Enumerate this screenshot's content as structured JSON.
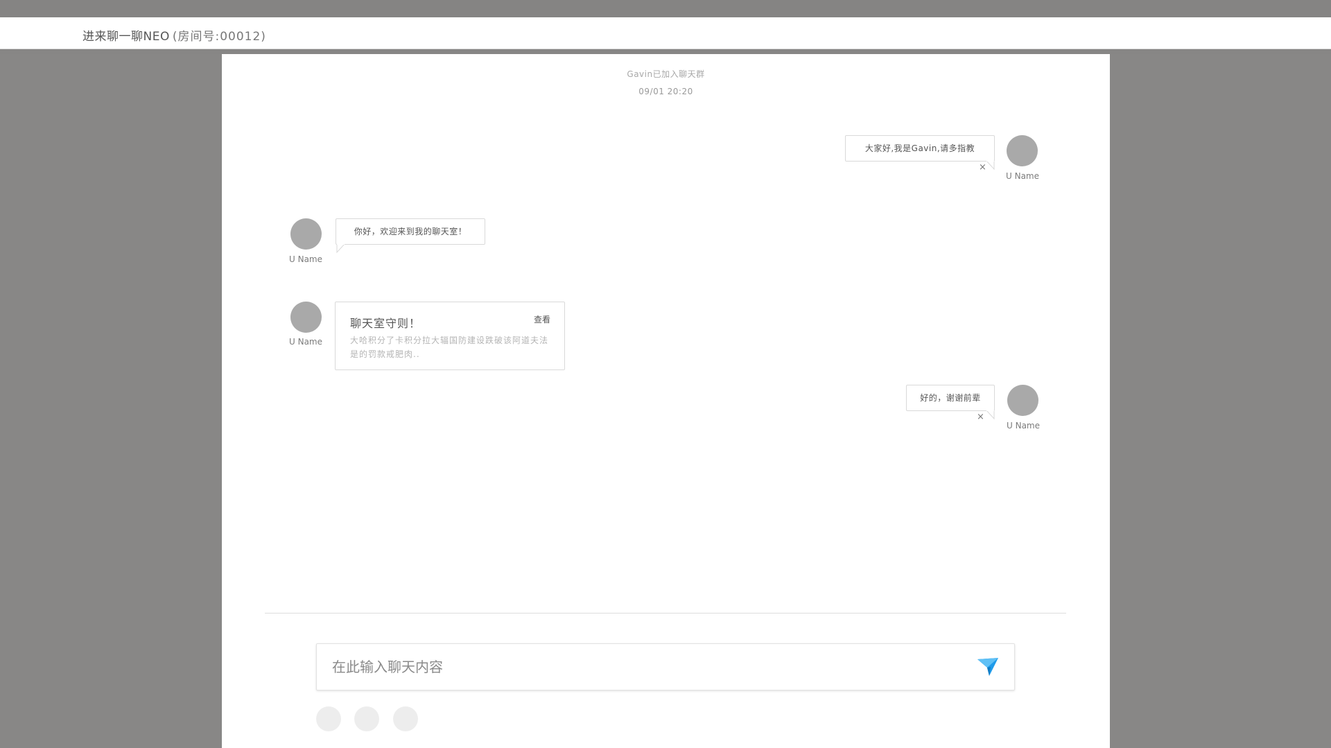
{
  "header": {
    "title": "进来聊一聊NEO",
    "room": "(房间号:00012)"
  },
  "system": {
    "join_notice": "Gavin已加入聊天群",
    "timestamp": "09/01 20:20"
  },
  "messages": [
    {
      "side": "right",
      "user": "U Name",
      "text": "大家好,我是Gavin,请多指教",
      "closable": true
    },
    {
      "side": "left",
      "user": "U Name",
      "text": "你好，欢迎来到我的聊天室！"
    },
    {
      "side": "left",
      "user": "U Name",
      "type": "card",
      "card_title": "聊天室守则！",
      "card_action": "查看",
      "card_body": "大哈积分了卡积分拉大辐国防建设跌破该阿道夫法是的罚款戒肥肉.."
    },
    {
      "side": "right",
      "user": "U Name",
      "text": "好的，谢谢前辈",
      "closable": true
    }
  ],
  "composer": {
    "placeholder": "在此输入聊天内容",
    "send_icon": "paper-plane-icon",
    "send_color": "#1f9bea"
  },
  "close_symbol": "×",
  "colors": {
    "backdrop": "#888786",
    "panel": "#ffffff",
    "avatar": "#a9a9a9",
    "accent": "#1f9bea"
  }
}
